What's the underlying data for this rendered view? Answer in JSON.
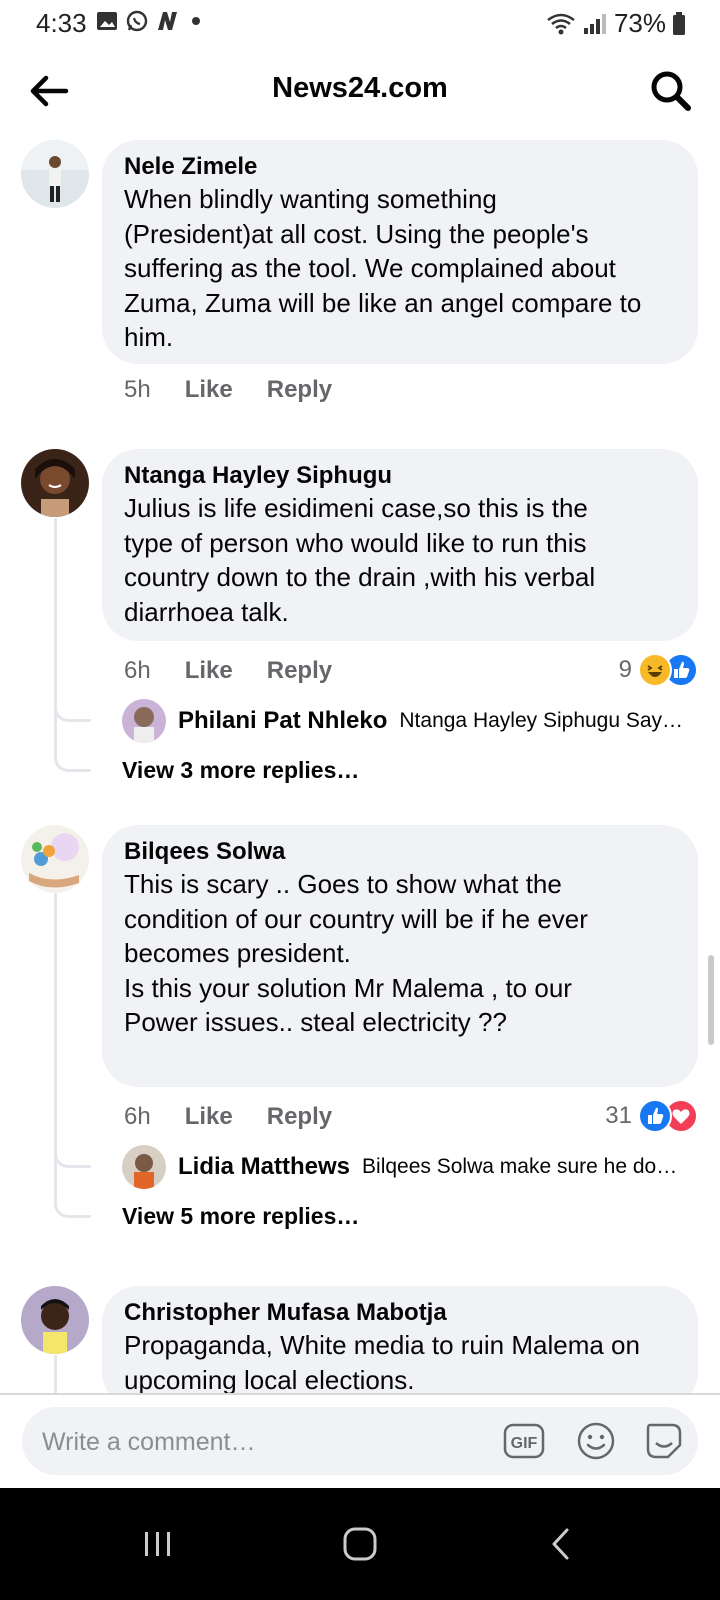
{
  "status_bar": {
    "time": "4:33",
    "battery": "73%"
  },
  "header": {
    "title": "News24.com"
  },
  "comments": [
    {
      "author": "Nele Zimele",
      "text": "When blindly wanting something\n(President)at  all cost. Using the people's\nsuffering as the tool. We complained about\nZuma, Zuma will be like an angel compare to\nhim.",
      "time": "5h",
      "like": "Like",
      "reply": "Reply"
    },
    {
      "author": "Ntanga Hayley Siphugu",
      "text": "Julius is life esidimeni case,so this is the\ntype of person who would like to run this\ncountry down to the drain ,with his verbal\ndiarrhoea talk.",
      "time": "6h",
      "like": "Like",
      "reply": "Reply",
      "reaction_count": "9",
      "reactions": [
        "haha-icon",
        "like-icon"
      ],
      "reply_preview": {
        "name": "Philani Pat Nhleko",
        "snippet": "Ntanga Hayley Siphugu Say…"
      },
      "view_more": "View 3 more replies…"
    },
    {
      "author": "Bilqees Solwa",
      "text": "This is scary .. Goes to show what the\ncondition of our country will be if he ever\nbecomes president.\nIs this your solution Mr Malema , to our\nPower issues.. steal electricity ??",
      "time": "6h",
      "like": "Like",
      "reply": "Reply",
      "reaction_count": "31",
      "reactions": [
        "like-icon",
        "love-icon"
      ],
      "reply_preview": {
        "name": "Lidia Matthews",
        "snippet": "Bilqees Solwa make sure he do…"
      },
      "view_more": "View 5 more replies…"
    },
    {
      "author": "Christopher Mufasa Mabotja",
      "text": "Propaganda, White media to ruin Malema on\nupcoming local elections."
    }
  ],
  "composer": {
    "placeholder": "Write a comment…",
    "gif_label": "GIF"
  },
  "colors": {
    "bubble": "#f0f2f5",
    "meta_text": "#65676b",
    "like_blue": "#1877f2",
    "love_red": "#f33e58",
    "haha_yellow": "#f7b928"
  }
}
